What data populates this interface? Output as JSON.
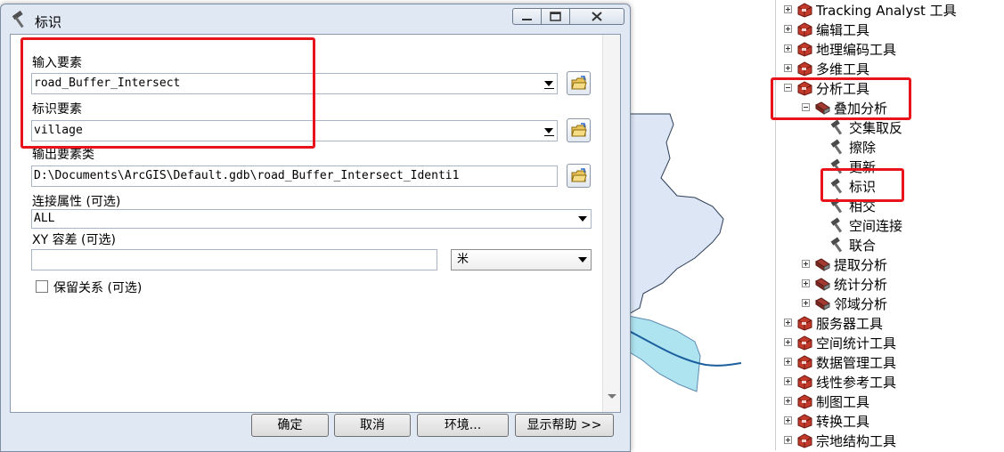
{
  "dialog": {
    "title": "标识",
    "fields": {
      "input_label": "输入要素",
      "input_value": "road_Buffer_Intersect",
      "identity_label": "标识要素",
      "identity_value": "village",
      "output_label": "输出要素类",
      "output_value": "D:\\Documents\\ArcGIS\\Default.gdb\\road_Buffer_Intersect_Identi1",
      "join_label": "连接属性 (可选)",
      "join_value": "ALL",
      "xy_label": "XY 容差 (可选)",
      "xy_value": "",
      "unit_value": "米",
      "keep_label": "保留关系 (可选)"
    },
    "buttons": {
      "ok": "确定",
      "cancel": "取消",
      "env": "环境...",
      "help": "显示帮助 >>"
    }
  },
  "toolbox_tree": [
    {
      "label": "Tracking Analyst 工具",
      "icon": "toolbox-icon",
      "expander": "plus",
      "level": 0
    },
    {
      "label": "编辑工具",
      "icon": "toolbox-icon",
      "expander": "plus",
      "level": 0
    },
    {
      "label": "地理编码工具",
      "icon": "toolbox-icon",
      "expander": "plus",
      "level": 0
    },
    {
      "label": "多维工具",
      "icon": "toolbox-icon",
      "expander": "plus",
      "level": 0
    },
    {
      "label": "分析工具",
      "icon": "toolbox-icon",
      "expander": "minus",
      "level": 0
    },
    {
      "label": "叠加分析",
      "icon": "toolset-icon",
      "expander": "minus",
      "level": 1
    },
    {
      "label": "交集取反",
      "icon": "hammer-icon",
      "expander": "none",
      "level": 2
    },
    {
      "label": "擦除",
      "icon": "hammer-icon",
      "expander": "none",
      "level": 2
    },
    {
      "label": "更新",
      "icon": "hammer-icon",
      "expander": "none",
      "level": 2
    },
    {
      "label": "标识",
      "icon": "hammer-icon",
      "expander": "none",
      "level": 2
    },
    {
      "label": "相交",
      "icon": "hammer-icon",
      "expander": "none",
      "level": 2
    },
    {
      "label": "空间连接",
      "icon": "hammer-icon",
      "expander": "none",
      "level": 2
    },
    {
      "label": "联合",
      "icon": "hammer-icon",
      "expander": "none",
      "level": 2
    },
    {
      "label": "提取分析",
      "icon": "toolset-icon",
      "expander": "plus",
      "level": 1
    },
    {
      "label": "统计分析",
      "icon": "toolset-icon",
      "expander": "plus",
      "level": 1
    },
    {
      "label": "邻域分析",
      "icon": "toolset-icon",
      "expander": "plus",
      "level": 1
    },
    {
      "label": "服务器工具",
      "icon": "toolbox-icon",
      "expander": "plus",
      "level": 0
    },
    {
      "label": "空间统计工具",
      "icon": "toolbox-icon",
      "expander": "plus",
      "level": 0
    },
    {
      "label": "数据管理工具",
      "icon": "toolbox-icon",
      "expander": "plus",
      "level": 0
    },
    {
      "label": "线性参考工具",
      "icon": "toolbox-icon",
      "expander": "plus",
      "level": 0
    },
    {
      "label": "制图工具",
      "icon": "toolbox-icon",
      "expander": "plus",
      "level": 0
    },
    {
      "label": "转换工具",
      "icon": "toolbox-icon",
      "expander": "plus",
      "level": 0
    },
    {
      "label": "宗地结构工具",
      "icon": "toolbox-icon",
      "expander": "plus",
      "level": 0
    }
  ],
  "colors": {
    "highlight": "#e8141b",
    "toolbox_red": "#c0392b",
    "map_fill": "#dce6f5",
    "buffer_fill": "#aee3f0",
    "road": "#1a5f9e"
  }
}
